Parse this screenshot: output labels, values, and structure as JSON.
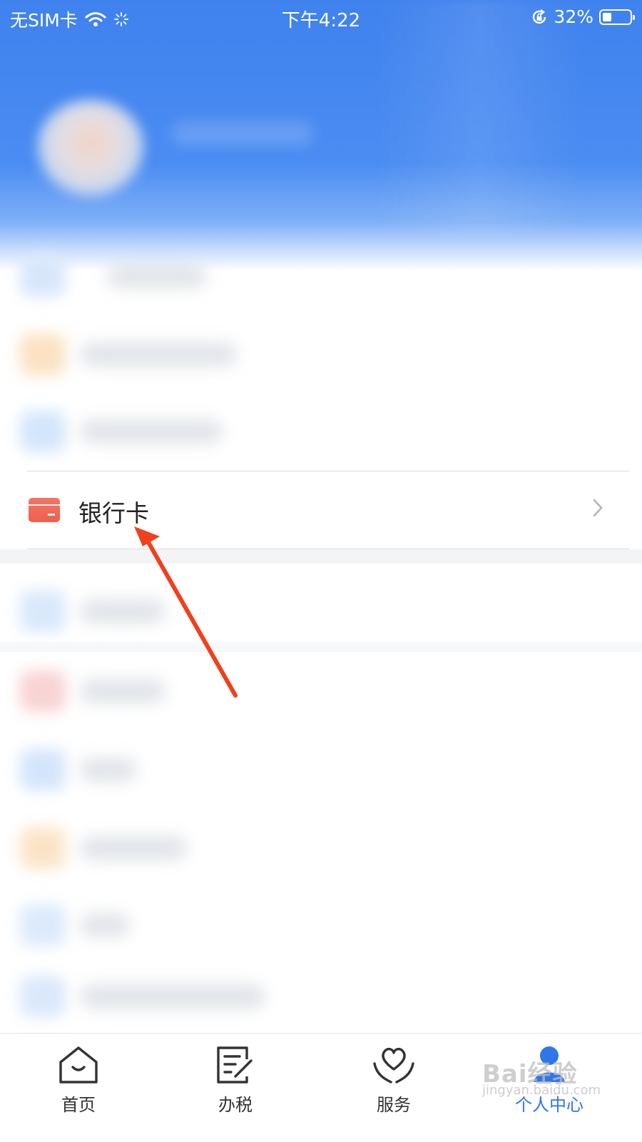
{
  "status_bar": {
    "carrier": "无SIM卡",
    "time": "下午4:22",
    "battery": "32%",
    "battery_level": 0.32
  },
  "menu": {
    "bank_card": {
      "label": "银行卡",
      "icon": "bank-card-icon"
    }
  },
  "tabs": [
    {
      "label": "首页",
      "icon": "home-icon",
      "active": false
    },
    {
      "label": "办税",
      "icon": "tax-form-icon",
      "active": false
    },
    {
      "label": "服务",
      "icon": "service-heart-icon",
      "active": false
    },
    {
      "label": "个人中心",
      "icon": "profile-icon",
      "active": true
    }
  ],
  "watermark": {
    "text": "Bai经验",
    "sub": "jingyan.baidu.com"
  },
  "colors": {
    "header_blue": "#3f82ee",
    "active_tab": "#2f76e8",
    "card_red": "#ef5f4f",
    "annotation_arrow": "#f0401e"
  }
}
